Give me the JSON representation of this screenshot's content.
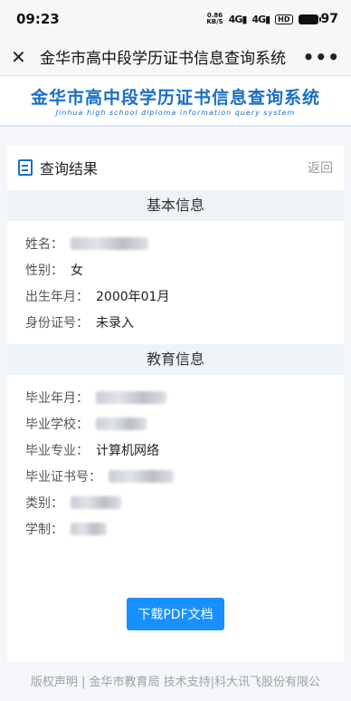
{
  "status_bar": {
    "time": "09:23",
    "net_speed_top": "0.86",
    "net_speed_bottom": "KB/S",
    "signal1": "4G",
    "signal2": "4G",
    "hd": "HD",
    "battery": "97"
  },
  "nav": {
    "title": "金华市高中段学历证书信息查询系统",
    "more": "•••"
  },
  "banner": {
    "title": "金华市高中段学历证书信息查询系统",
    "subtitle": "Jinhua high school diploma information query system"
  },
  "card": {
    "title": "查询结果",
    "back_label": "返回",
    "basic_section": {
      "title": "基本信息",
      "name_label": "姓名：",
      "gender_label": "性别：",
      "gender_value": "女",
      "birth_label": "出生年月：",
      "birth_value": "2000年01月",
      "id_label": "身份证号：",
      "id_value": "未录入"
    },
    "edu_section": {
      "title": "教育信息",
      "grad_date_label": "毕业年月：",
      "school_label": "毕业学校：",
      "major_label": "毕业专业：",
      "major_value": "计算机网络",
      "cert_no_label": "毕业证书号：",
      "category_label": "类别：",
      "duration_label": "学制："
    },
    "download_button": "下载PDF文档"
  },
  "footer": "版权声明 | 金华市教育局   技术支持|科大讯飞股份有限公",
  "colors": {
    "accent": "#1890ff",
    "brand": "#1a6fc4",
    "section_bg": "#eef3f8"
  }
}
